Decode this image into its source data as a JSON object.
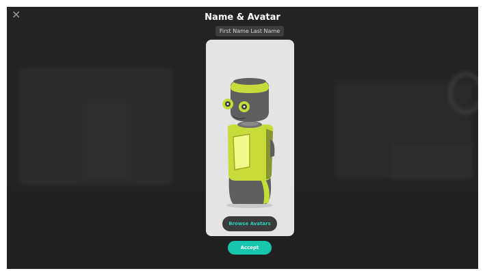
{
  "dialog": {
    "title": "Name & Avatar",
    "close_icon": "close-icon",
    "name_input": {
      "value": "",
      "placeholder": "First Name Last Name"
    },
    "browse_button_label": "Browse Avatars",
    "accept_button_label": "Accept"
  },
  "colors": {
    "accent": "#16c7ae",
    "browse_text": "#22d3b8",
    "backdrop": "#232323",
    "card": "#e4e4e4",
    "robot_primary": "#c7dc3a",
    "robot_secondary": "#5f5f5f"
  }
}
